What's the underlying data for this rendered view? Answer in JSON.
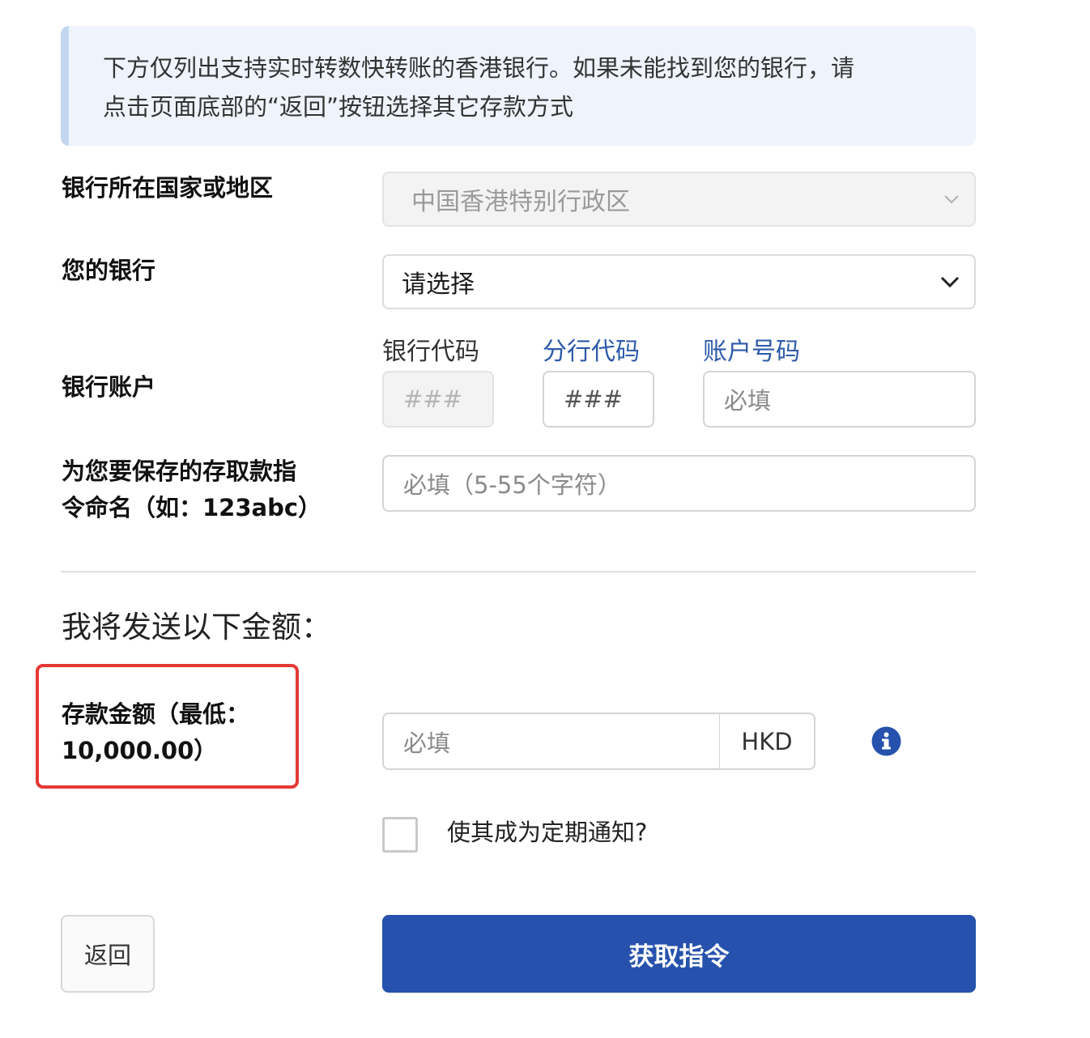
{
  "notice": {
    "line1": "下方仅列出支持实时转数快转账的香港银行。如果未能找到您的银行，请",
    "line2": "点击页面底部的“返回”按钮选择其它存款方式"
  },
  "country": {
    "label": "银行所在国家或地区",
    "value": "中国香港特别行政区"
  },
  "bank": {
    "label": "您的银行",
    "value": "请选择"
  },
  "account": {
    "label": "银行账户",
    "bank_code_label": "银行代码",
    "bank_code_placeholder": "###",
    "branch_code_label": "分行代码",
    "branch_code_placeholder": "###",
    "account_number_label": "账户号码",
    "account_number_placeholder": "必填"
  },
  "instruction_name": {
    "label_line1": "为您要保存的存取款指",
    "label_line2": "令命名（如：123abc）",
    "placeholder": "必填（5-55个字符）"
  },
  "amount_section": {
    "title": "我将发送以下金额："
  },
  "deposit": {
    "label_line1": "存款金额（最低：",
    "label_line2": "10,000.00）",
    "placeholder": "必填",
    "currency": "HKD",
    "info_icon": "info-icon"
  },
  "recurring": {
    "label": "使其成为定期通知?",
    "checked": false
  },
  "actions": {
    "back_label": "返回",
    "submit_label": "获取指令"
  },
  "colors": {
    "primary": "#2652ad",
    "link": "#2d5aa8",
    "highlight": "#e53935",
    "notice_bg": "#eff4fc"
  }
}
